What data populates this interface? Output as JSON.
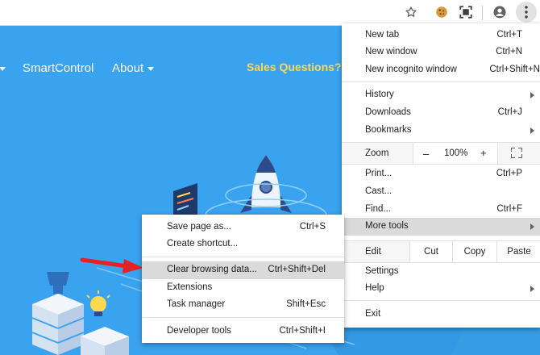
{
  "toolbar": {
    "icons": [
      "star-icon",
      "cookie-extension-icon",
      "screen-capture-extension-icon",
      "account-icon",
      "menu-kebab-icon"
    ]
  },
  "site": {
    "nav": [
      {
        "label": "SmartControl",
        "has_caret": false
      },
      {
        "label": "About",
        "has_caret": true
      }
    ],
    "sales_label": "Sales Questions?",
    "colors": {
      "background": "#3aa3ef",
      "sales": "#ffd84d",
      "arrow": "#e8201f"
    }
  },
  "menu": {
    "items": [
      {
        "label": "New tab",
        "shortcut": "Ctrl+T"
      },
      {
        "label": "New window",
        "shortcut": "Ctrl+N"
      },
      {
        "label": "New incognito window",
        "shortcut": "Ctrl+Shift+N"
      },
      {
        "label": "History",
        "shortcut": ""
      },
      {
        "label": "Downloads",
        "shortcut": "Ctrl+J"
      },
      {
        "label": "Bookmarks",
        "shortcut": ""
      },
      {
        "label": "Print...",
        "shortcut": "Ctrl+P"
      },
      {
        "label": "Cast...",
        "shortcut": ""
      },
      {
        "label": "Find...",
        "shortcut": "Ctrl+F"
      },
      {
        "label": "More tools",
        "shortcut": ""
      },
      {
        "label": "Settings",
        "shortcut": ""
      },
      {
        "label": "Help",
        "shortcut": ""
      },
      {
        "label": "Exit",
        "shortcut": ""
      }
    ],
    "zoom": {
      "label": "Zoom",
      "minus": "–",
      "value": "100%",
      "plus": "+"
    },
    "edit": {
      "label": "Edit",
      "cut": "Cut",
      "copy": "Copy",
      "paste": "Paste"
    }
  },
  "submenu": {
    "items": [
      {
        "label": "Save page as...",
        "shortcut": "Ctrl+S"
      },
      {
        "label": "Create shortcut...",
        "shortcut": ""
      },
      {
        "label": "Clear browsing data...",
        "shortcut": "Ctrl+Shift+Del"
      },
      {
        "label": "Extensions",
        "shortcut": ""
      },
      {
        "label": "Task manager",
        "shortcut": "Shift+Esc"
      },
      {
        "label": "Developer tools",
        "shortcut": "Ctrl+Shift+I"
      }
    ]
  }
}
